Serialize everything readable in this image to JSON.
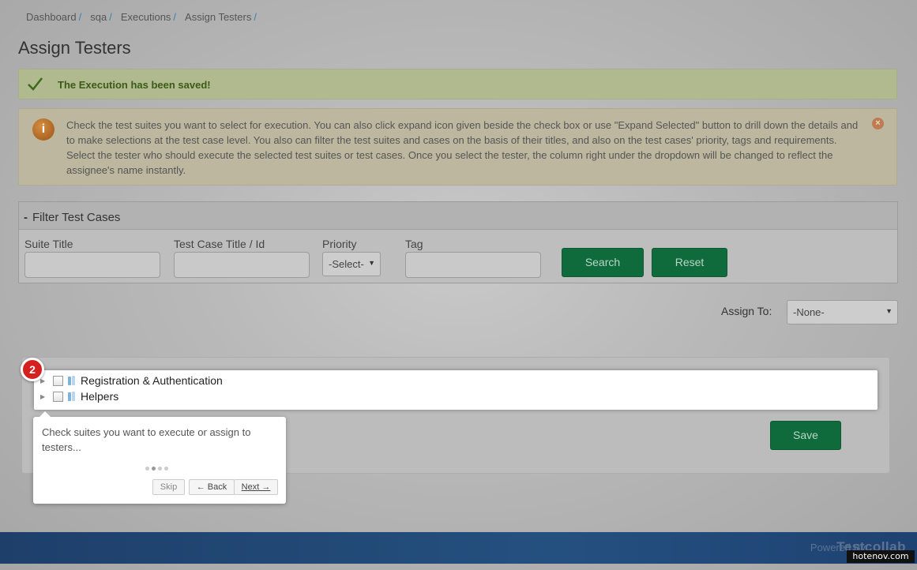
{
  "breadcrumb": [
    {
      "label": "Dashboard",
      "sep": "/"
    },
    {
      "label": "sqa",
      "sep": "/"
    },
    {
      "label": "Executions",
      "sep": "/"
    },
    {
      "label": "Assign Testers",
      "sep": "/"
    }
  ],
  "page_title": "Assign Testers",
  "success_alert": {
    "message": "The Execution has been saved!"
  },
  "info_alert": {
    "icon_char": "i",
    "text": "Check the test suites you want to select for execution. You can also click expand icon given beside the check box or use \"Expand Selected\" button to drill down the details and to make selections at the test case level. You also can filter the test suites and cases on the basis of their titles, and also on the test cases' priority, tags and requirements. Select the tester who should execute the selected test suites or test cases. Once you select the tester, the column right under the dropdown will be changed to reflect the assignee's name instantly.",
    "close_char": "×"
  },
  "filter": {
    "collapse_char": "-",
    "title": "Filter Test Cases",
    "suite_title_label": "Suite Title",
    "suite_title_value": "",
    "test_case_label": "Test Case Title / Id",
    "test_case_value": "",
    "priority_label": "Priority",
    "priority_selected": "-Select-",
    "tag_label": "Tag",
    "tag_value": "",
    "search_label": "Search",
    "reset_label": "Reset"
  },
  "assign": {
    "label": "Assign To:",
    "selected": "-None-"
  },
  "tree": {
    "items": [
      {
        "label": "Registration & Authentication"
      },
      {
        "label": "Helpers"
      }
    ]
  },
  "save_label": "Save",
  "tour": {
    "step_number": "2",
    "content": "Check suites you want to execute or assign to testers...",
    "skip_label": "Skip",
    "back_label": "← Back",
    "next_label": "Next →"
  },
  "footer": {
    "powered_by": "Powered By",
    "brand": "Testcollab"
  },
  "watermark": "hotenov.com",
  "colors": {
    "success_bg": "#b1b98f",
    "info_bg": "#bdb79f",
    "button_green": "#0f6a3c",
    "footer_blue": "#24507f",
    "step_badge": "#d52020"
  }
}
